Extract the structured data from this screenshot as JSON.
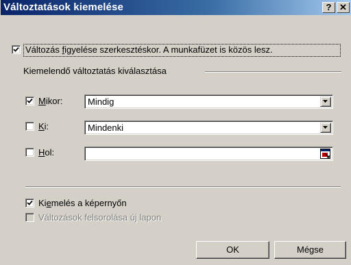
{
  "window": {
    "title": "Változtatások kiemelése",
    "help_button": "?",
    "close_button": "✕"
  },
  "track_changes": {
    "checked": true,
    "prefix": "Változás ",
    "accel": "f",
    "suffix": "igyelése szerkesztéskor. A munkafüzet is közös lesz."
  },
  "group": {
    "label": "Kiemelendő változtatás kiválasztása"
  },
  "when": {
    "checked": true,
    "accel": "M",
    "rest": "ikor:",
    "value": "Mindig"
  },
  "who": {
    "checked": false,
    "accel": "K",
    "rest": "i:",
    "value": "Mindenki"
  },
  "where": {
    "checked": false,
    "accel": "H",
    "rest": "ol:",
    "value": ""
  },
  "highlight_screen": {
    "checked": true,
    "pre": "Ki",
    "accel": "e",
    "post": "melés a képernyőn"
  },
  "list_new_sheet": {
    "checked": false,
    "disabled": true,
    "text": "Változások felsorolása új lapon"
  },
  "buttons": {
    "ok": "OK",
    "cancel": "Mégse"
  }
}
